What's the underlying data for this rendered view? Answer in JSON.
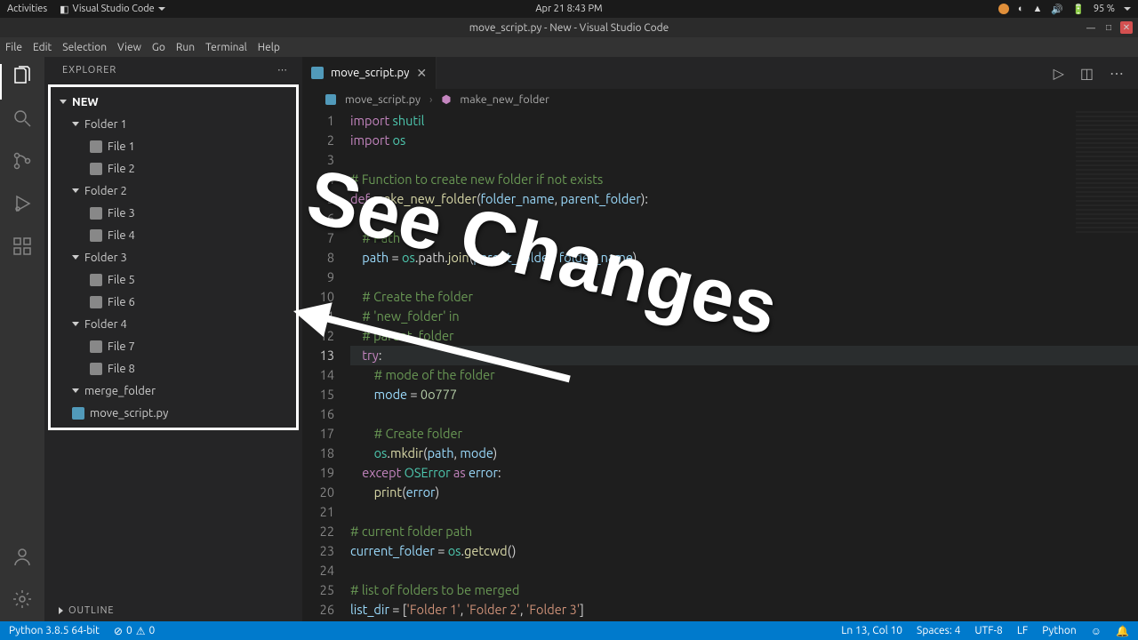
{
  "system_bar": {
    "activities": "Activities",
    "app_name": "Visual Studio Code",
    "datetime": "Apr 21  8:43 PM",
    "battery": "95 %"
  },
  "title_bar": {
    "title": "move_script.py - New - Visual Studio Code"
  },
  "menu_bar": {
    "items": [
      "File",
      "Edit",
      "Selection",
      "View",
      "Go",
      "Run",
      "Terminal",
      "Help"
    ]
  },
  "sidebar": {
    "title": "EXPLORER",
    "root": "NEW",
    "tree": [
      {
        "type": "folder",
        "label": "Folder 1",
        "children": [
          {
            "label": "File 1"
          },
          {
            "label": "File 2"
          }
        ]
      },
      {
        "type": "folder",
        "label": "Folder 2",
        "children": [
          {
            "label": "File 3"
          },
          {
            "label": "File 4"
          }
        ]
      },
      {
        "type": "folder",
        "label": "Folder 3",
        "children": [
          {
            "label": "File 5"
          },
          {
            "label": "File 6"
          }
        ]
      },
      {
        "type": "folder",
        "label": "Folder 4",
        "children": [
          {
            "label": "File 7"
          },
          {
            "label": "File 8"
          }
        ]
      },
      {
        "type": "folder",
        "label": "merge_folder",
        "children": []
      },
      {
        "type": "file",
        "label": "move_script.py"
      }
    ],
    "outline": "OUTLINE"
  },
  "tabs": {
    "items": [
      {
        "label": "move_script.py"
      }
    ]
  },
  "breadcrumb": {
    "file": "move_script.py",
    "symbol": "make_new_folder"
  },
  "code": {
    "lines": [
      {
        "n": 1,
        "tokens": [
          {
            "t": "import ",
            "c": "kw"
          },
          {
            "t": "shutil",
            "c": "cls"
          }
        ]
      },
      {
        "n": 2,
        "tokens": [
          {
            "t": "import ",
            "c": "kw"
          },
          {
            "t": "os",
            "c": "cls"
          }
        ]
      },
      {
        "n": 3,
        "tokens": [
          {
            "t": "",
            "c": ""
          }
        ]
      },
      {
        "n": 4,
        "tokens": [
          {
            "t": "# Function to create new folder if not exists",
            "c": "cm"
          }
        ]
      },
      {
        "n": 5,
        "tokens": [
          {
            "t": "def ",
            "c": "kw"
          },
          {
            "t": "make_new_folder",
            "c": "fn"
          },
          {
            "t": "(",
            "c": "op"
          },
          {
            "t": "folder_name",
            "c": "var"
          },
          {
            "t": ", ",
            "c": "op"
          },
          {
            "t": "parent_folder",
            "c": "var"
          },
          {
            "t": "):",
            "c": "op"
          }
        ]
      },
      {
        "n": 6,
        "tokens": [
          {
            "t": "",
            "c": ""
          }
        ]
      },
      {
        "n": 7,
        "tokens": [
          {
            "t": "    ",
            "c": ""
          },
          {
            "t": "# Path",
            "c": "cm"
          }
        ]
      },
      {
        "n": 8,
        "tokens": [
          {
            "t": "    ",
            "c": ""
          },
          {
            "t": "path",
            "c": "var"
          },
          {
            "t": " = ",
            "c": "op"
          },
          {
            "t": "os",
            "c": "cls"
          },
          {
            "t": ".path.",
            "c": "op"
          },
          {
            "t": "join",
            "c": "fn"
          },
          {
            "t": "(",
            "c": "op"
          },
          {
            "t": "parent_folder",
            "c": "var"
          },
          {
            "t": ", ",
            "c": "op"
          },
          {
            "t": "folder_name",
            "c": "var"
          },
          {
            "t": ")",
            "c": "op"
          }
        ]
      },
      {
        "n": 9,
        "tokens": [
          {
            "t": "",
            "c": ""
          }
        ]
      },
      {
        "n": 10,
        "tokens": [
          {
            "t": "    ",
            "c": ""
          },
          {
            "t": "# Create the folder",
            "c": "cm"
          }
        ]
      },
      {
        "n": 11,
        "tokens": [
          {
            "t": "    ",
            "c": ""
          },
          {
            "t": "# 'new_folder' in",
            "c": "cm"
          }
        ]
      },
      {
        "n": 12,
        "tokens": [
          {
            "t": "    ",
            "c": ""
          },
          {
            "t": "# parent_folder",
            "c": "cm"
          }
        ]
      },
      {
        "n": 13,
        "tokens": [
          {
            "t": "    ",
            "c": ""
          },
          {
            "t": "try",
            "c": "kw"
          },
          {
            "t": ":",
            "c": "op"
          }
        ],
        "active": true
      },
      {
        "n": 14,
        "tokens": [
          {
            "t": "        ",
            "c": ""
          },
          {
            "t": "# mode of the folder",
            "c": "cm"
          }
        ]
      },
      {
        "n": 15,
        "tokens": [
          {
            "t": "        ",
            "c": ""
          },
          {
            "t": "mode",
            "c": "var"
          },
          {
            "t": " = ",
            "c": "op"
          },
          {
            "t": "0o777",
            "c": "num"
          }
        ]
      },
      {
        "n": 16,
        "tokens": [
          {
            "t": "",
            "c": ""
          }
        ]
      },
      {
        "n": 17,
        "tokens": [
          {
            "t": "        ",
            "c": ""
          },
          {
            "t": "# Create folder",
            "c": "cm"
          }
        ]
      },
      {
        "n": 18,
        "tokens": [
          {
            "t": "        ",
            "c": ""
          },
          {
            "t": "os",
            "c": "cls"
          },
          {
            "t": ".",
            "c": "op"
          },
          {
            "t": "mkdir",
            "c": "fn"
          },
          {
            "t": "(",
            "c": "op"
          },
          {
            "t": "path",
            "c": "var"
          },
          {
            "t": ", ",
            "c": "op"
          },
          {
            "t": "mode",
            "c": "var"
          },
          {
            "t": ")",
            "c": "op"
          }
        ]
      },
      {
        "n": 19,
        "tokens": [
          {
            "t": "    ",
            "c": ""
          },
          {
            "t": "except ",
            "c": "kw"
          },
          {
            "t": "OSError",
            "c": "cls"
          },
          {
            "t": " as ",
            "c": "kw"
          },
          {
            "t": "error",
            "c": "var"
          },
          {
            "t": ":",
            "c": "op"
          }
        ]
      },
      {
        "n": 20,
        "tokens": [
          {
            "t": "        ",
            "c": ""
          },
          {
            "t": "print",
            "c": "fn"
          },
          {
            "t": "(",
            "c": "op"
          },
          {
            "t": "error",
            "c": "var"
          },
          {
            "t": ")",
            "c": "op"
          }
        ]
      },
      {
        "n": 21,
        "tokens": [
          {
            "t": "",
            "c": ""
          }
        ]
      },
      {
        "n": 22,
        "tokens": [
          {
            "t": "# current folder path",
            "c": "cm"
          }
        ]
      },
      {
        "n": 23,
        "tokens": [
          {
            "t": "current_folder",
            "c": "var"
          },
          {
            "t": " = ",
            "c": "op"
          },
          {
            "t": "os",
            "c": "cls"
          },
          {
            "t": ".",
            "c": "op"
          },
          {
            "t": "getcwd",
            "c": "fn"
          },
          {
            "t": "()",
            "c": "op"
          }
        ]
      },
      {
        "n": 24,
        "tokens": [
          {
            "t": "",
            "c": ""
          }
        ]
      },
      {
        "n": 25,
        "tokens": [
          {
            "t": "# list of folders to be merged",
            "c": "cm"
          }
        ]
      },
      {
        "n": 26,
        "tokens": [
          {
            "t": "list_dir",
            "c": "var"
          },
          {
            "t": " = [",
            "c": "op"
          },
          {
            "t": "'Folder 1'",
            "c": "str"
          },
          {
            "t": ", ",
            "c": "op"
          },
          {
            "t": "'Folder 2'",
            "c": "str"
          },
          {
            "t": ", ",
            "c": "op"
          },
          {
            "t": "'Folder 3'",
            "c": "str"
          },
          {
            "t": "]",
            "c": "op"
          }
        ]
      }
    ]
  },
  "status": {
    "python_version": "Python 3.8.5 64-bit",
    "errors": "0",
    "warnings": "0",
    "lncol": "Ln 13, Col 10",
    "spaces": "Spaces: 4",
    "encoding": "UTF-8",
    "eol": "LF",
    "language": "Python"
  },
  "annotation": {
    "text": "See Changes"
  }
}
